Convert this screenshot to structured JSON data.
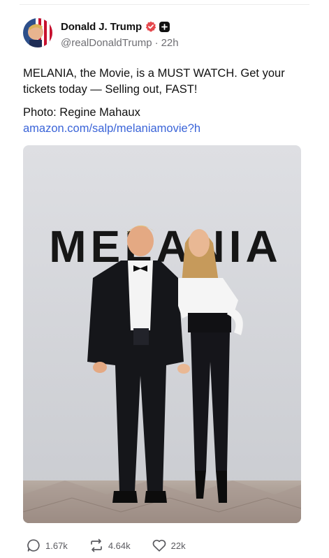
{
  "post": {
    "author": {
      "display_name": "Donald J. Trump",
      "handle": "@realDonaldTrump",
      "separator": "·",
      "time": "22h",
      "verified": true
    },
    "text": "MELANIA, the Movie, is a MUST WATCH. Get your tickets today — Selling out, FAST!",
    "photo_credit": "Photo: Regine Mahaux",
    "link": "amazon.com/salp/melaniamovie?h",
    "media": {
      "backdrop_text": "MELANIA"
    },
    "stats": {
      "replies": "1.67k",
      "reposts": "4.64k",
      "likes": "22k"
    }
  },
  "colors": {
    "link": "#3a64d8",
    "verified_badge": "#e5484d",
    "muted_text": "#6e6e73"
  }
}
